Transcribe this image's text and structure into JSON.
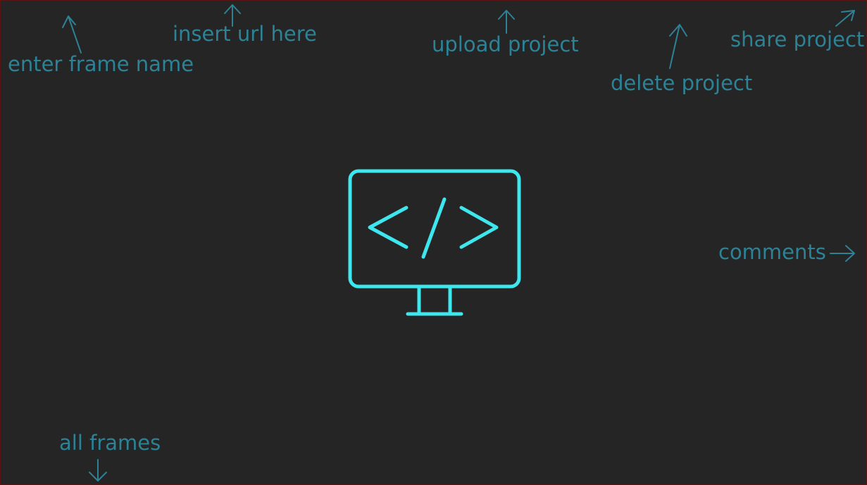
{
  "hints": {
    "enter_frame_name": "enter frame name",
    "insert_url": "insert url here",
    "upload_project": "upload project",
    "delete_project": "delete project",
    "share_project": "share project",
    "comments": "comments",
    "all_frames": "all frames"
  },
  "center": {
    "icon": "monitor-code-icon"
  },
  "colors": {
    "background": "#252525",
    "hint_text": "#2d8296",
    "accent": "#3ee6ee",
    "border": "#5a1414"
  }
}
